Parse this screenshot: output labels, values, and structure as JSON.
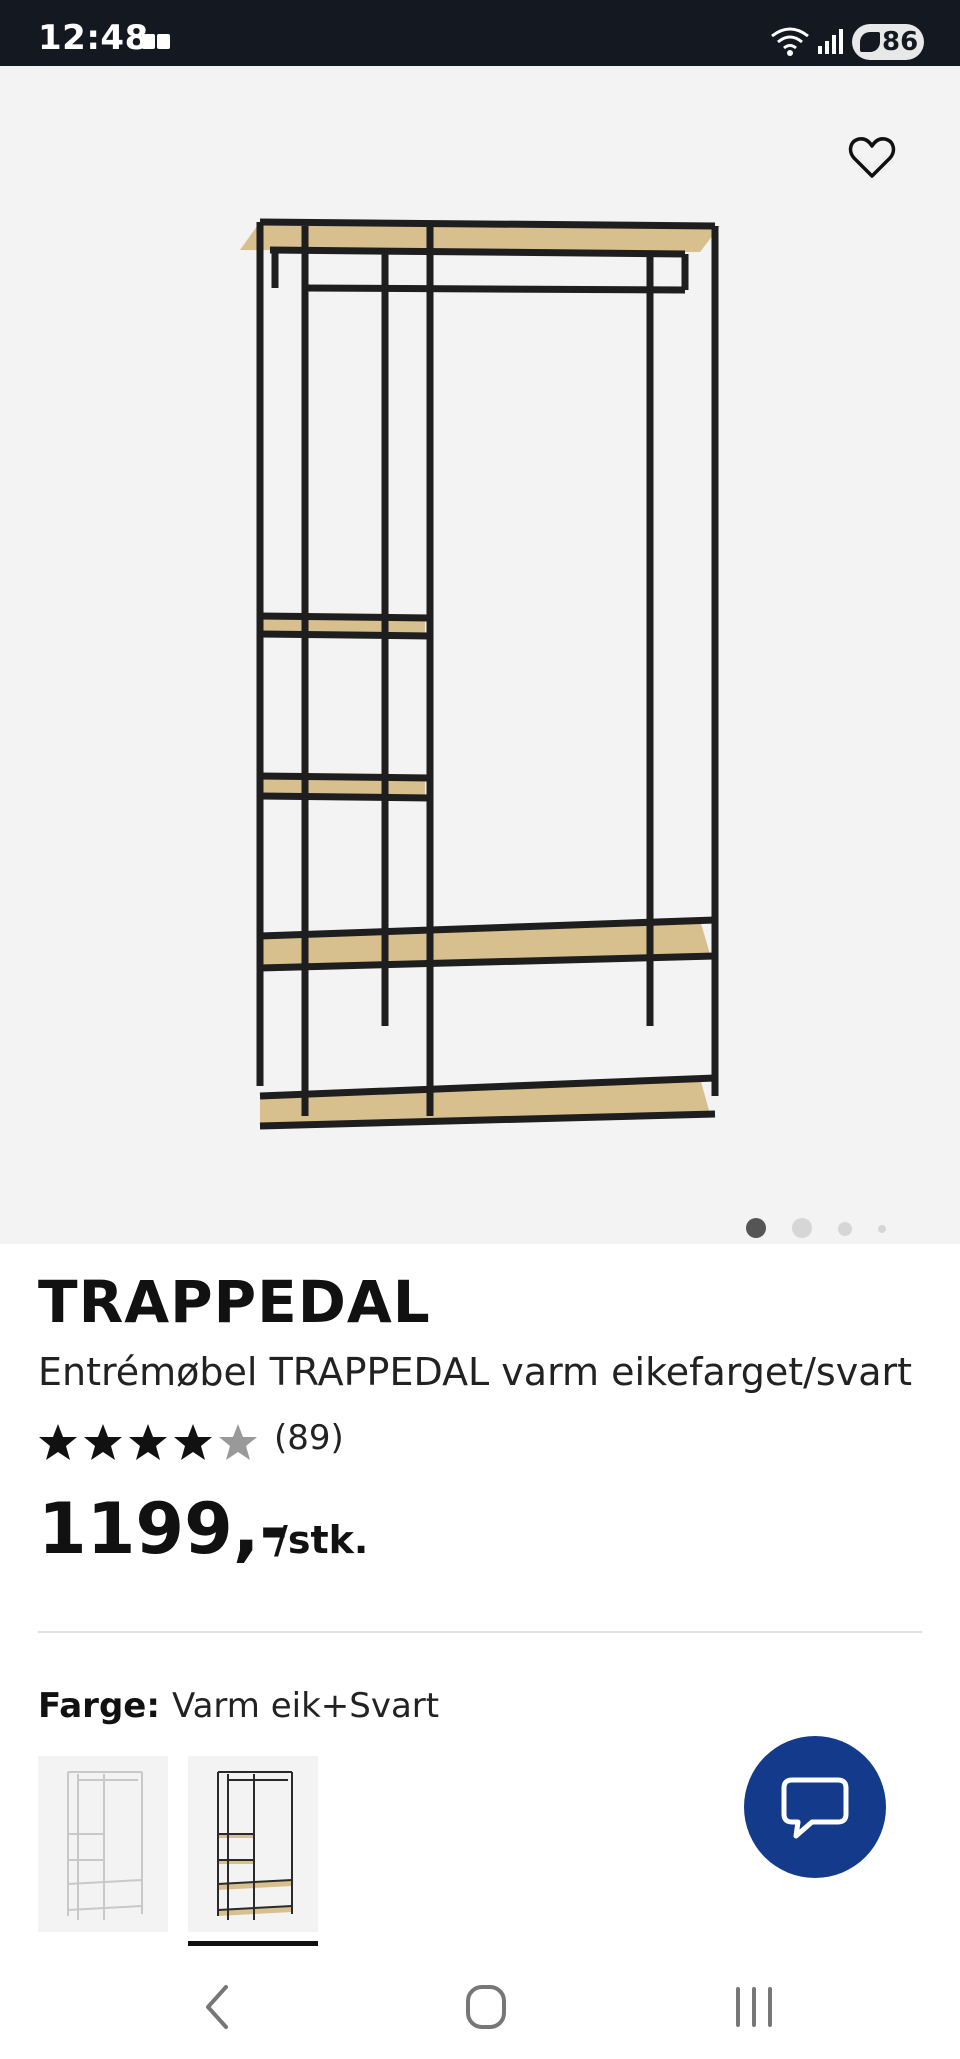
{
  "status_bar": {
    "time": "12:48",
    "battery": "86",
    "icons": [
      "message-icon",
      "wifi-icon",
      "signal-icon",
      "battery-icon"
    ]
  },
  "hero": {
    "favorite_icon": "heart-outline-icon",
    "carousel": {
      "count": 4,
      "active_index": 0
    }
  },
  "product": {
    "name": "TRAPPEDAL",
    "description": "Entrémøbel TRAPPEDAL varm eikefarget/svart",
    "rating": {
      "stars": 5,
      "filled_fraction": 0.9,
      "review_count": "(89)"
    },
    "price": "1199,-",
    "price_unit": "/stk."
  },
  "color": {
    "label": "Farge:",
    "value": "Varm eik+Svart",
    "swatches": [
      {
        "name": "white",
        "selected": false
      },
      {
        "name": "varm-eik-svart",
        "selected": true
      }
    ]
  },
  "chat": {
    "icon": "chat-bubble-icon",
    "color": "#143a8c"
  },
  "nav": {
    "items": [
      "back-icon",
      "home-icon",
      "recent-apps-icon"
    ]
  }
}
